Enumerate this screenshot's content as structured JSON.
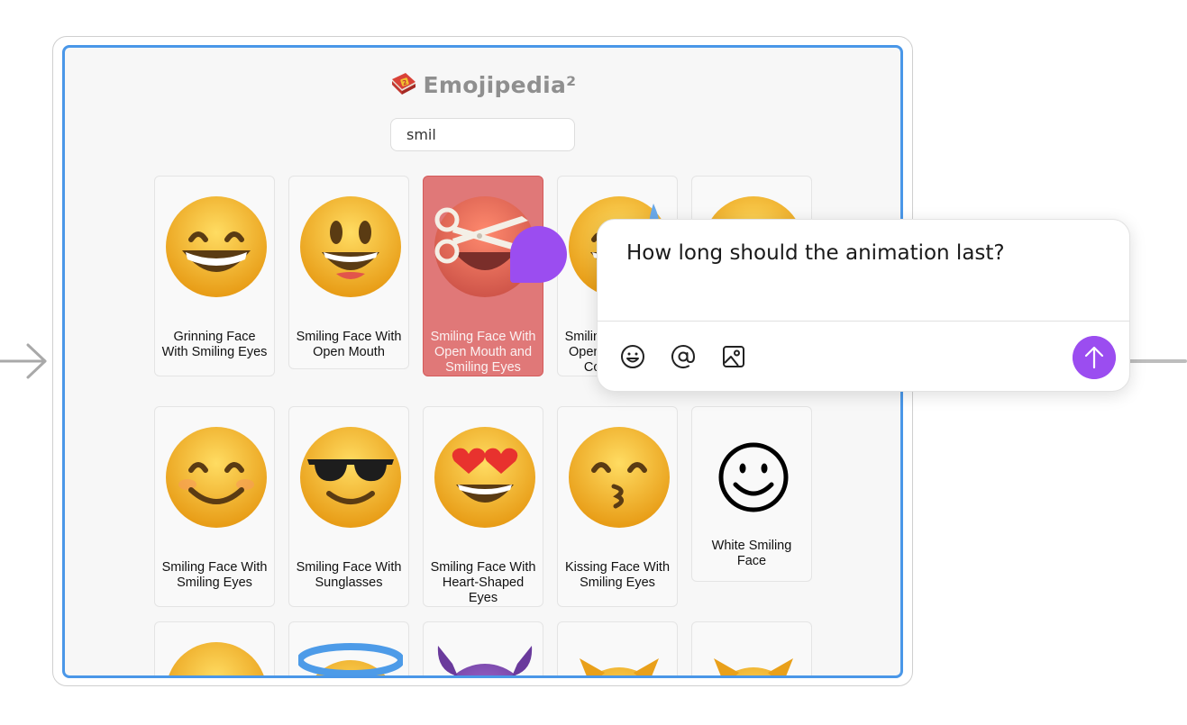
{
  "app": {
    "brand_name": "Emojipedia²",
    "brand_icon": "book-icon"
  },
  "search": {
    "value": "smil"
  },
  "emojis": [
    {
      "name": "Grinning Face With Smiling Eyes",
      "icon": "grinning-face-with-smiling-eyes-icon"
    },
    {
      "name": "Smiling Face With Open Mouth",
      "icon": "smiling-face-with-open-mouth-icon"
    },
    {
      "name": "Smiling Face With Open Mouth and Smiling Eyes",
      "icon": "smiling-face-with-open-mouth-and-smiling-eyes-icon",
      "selected": true
    },
    {
      "name": "Smiling Face With Open Mouth and Cold Sweat",
      "icon": "smiling-face-with-open-mouth-and-cold-sweat-icon"
    },
    {
      "name": "",
      "icon": "smiling-face-icon"
    },
    {
      "name": "Smiling Face With Smiling Eyes",
      "icon": "smiling-face-with-smiling-eyes-icon"
    },
    {
      "name": "Smiling Face With Sunglasses",
      "icon": "smiling-face-with-sunglasses-icon"
    },
    {
      "name": "Smiling Face With Heart-Shaped Eyes",
      "icon": "smiling-face-with-heart-shaped-eyes-icon"
    },
    {
      "name": "Kissing Face With Smiling Eyes",
      "icon": "kissing-face-with-smiling-eyes-icon"
    },
    {
      "name": "White Smiling Face",
      "icon": "white-smiling-face-icon"
    },
    {
      "name": "",
      "icon": "slightly-smiling-face-icon"
    },
    {
      "name": "",
      "icon": "smiling-face-with-halo-icon"
    },
    {
      "name": "",
      "icon": "smiling-face-with-horns-icon"
    },
    {
      "name": "",
      "icon": "grinning-cat-face-icon"
    },
    {
      "name": "",
      "icon": "smiling-cat-face-icon"
    }
  ],
  "comment_popup": {
    "question": "How long should the animation last?",
    "tools": [
      "emoji-icon",
      "mention-icon",
      "image-icon"
    ],
    "send_icon": "arrow-up-icon"
  },
  "colors": {
    "viewport_border": "#4a97e8",
    "selected_card": "#e07878",
    "accent_purple": "#9b4df0"
  }
}
